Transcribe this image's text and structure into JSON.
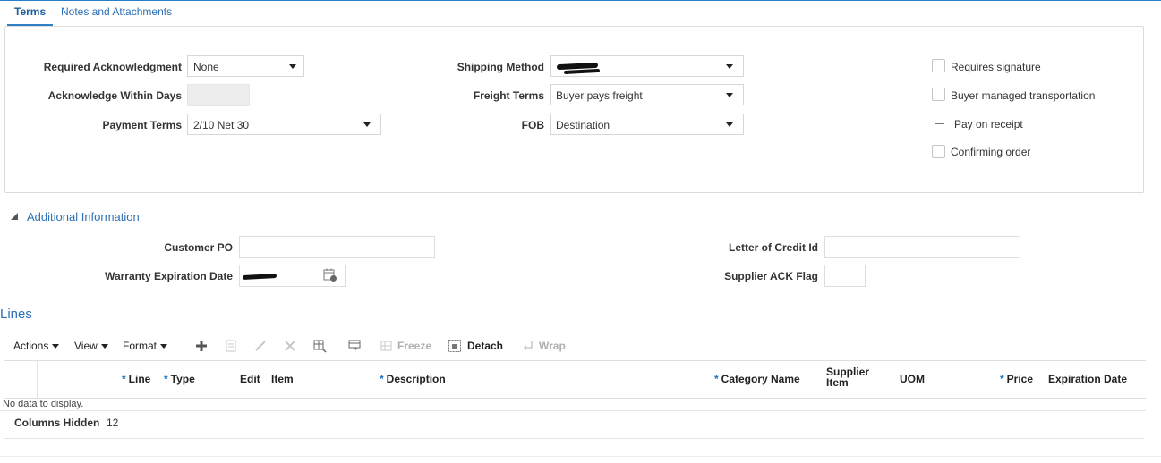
{
  "tabs": {
    "terms": "Terms",
    "notes": "Notes and Attachments"
  },
  "terms": {
    "required_ack_label": "Required Acknowledgment",
    "required_ack_value": "None",
    "ack_within_days_label": "Acknowledge Within Days",
    "payment_terms_label": "Payment Terms",
    "payment_terms_value": "2/10 Net 30",
    "shipping_method_label": "Shipping Method",
    "freight_terms_label": "Freight Terms",
    "freight_terms_value": "Buyer pays freight",
    "fob_label": "FOB",
    "fob_value": "Destination",
    "requires_signature": "Requires signature",
    "buyer_managed_transportation": "Buyer managed transportation",
    "pay_on_receipt": "Pay on receipt",
    "confirming_order": "Confirming order"
  },
  "additional": {
    "title": "Additional Information",
    "customer_po_label": "Customer PO",
    "warranty_label": "Warranty Expiration Date",
    "letter_of_credit_label": "Letter of Credit Id",
    "supplier_ack_label": "Supplier ACK Flag"
  },
  "lines": {
    "title": "Lines",
    "toolbar": {
      "actions": "Actions",
      "view": "View",
      "format": "Format",
      "freeze": "Freeze",
      "detach": "Detach",
      "wrap": "Wrap"
    },
    "columns": {
      "line": "Line",
      "type": "Type",
      "edit": "Edit",
      "item": "Item",
      "description": "Description",
      "category_name": "Category Name",
      "supplier_item_1": "Supplier",
      "supplier_item_2": "Item",
      "uom": "UOM",
      "price": "Price",
      "expiration_date": "Expiration Date"
    },
    "required_marker": "*",
    "no_data": "No data to display.",
    "columns_hidden_label": "Columns Hidden",
    "columns_hidden_value": "12"
  },
  "colors": {
    "accent": "#2b6fb5",
    "required": "#1b74c7"
  }
}
